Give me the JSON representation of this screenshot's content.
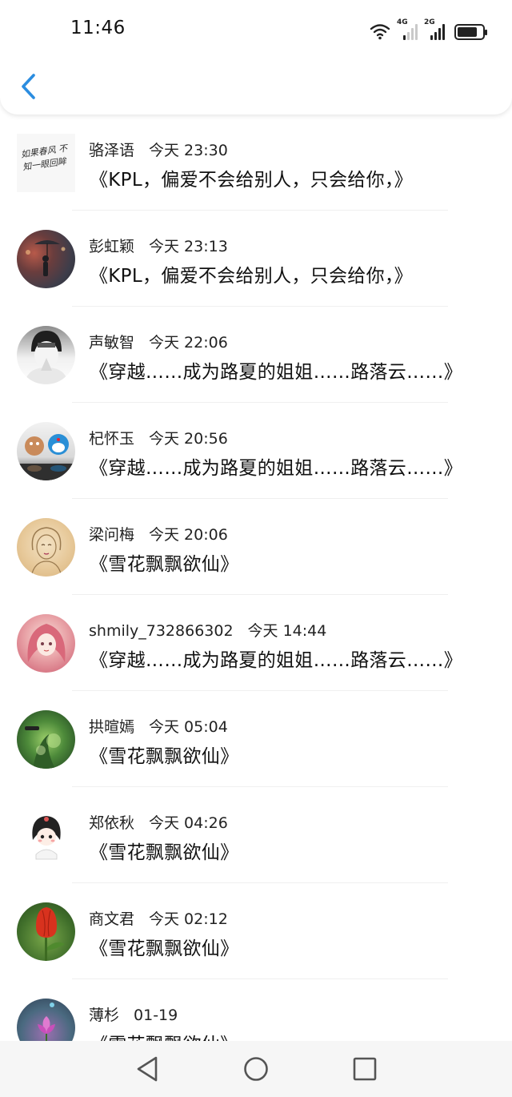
{
  "status_bar": {
    "time": "11:46",
    "network_1": "4G",
    "network_2": "2G",
    "icons": [
      "wifi-icon",
      "signal-4g-icon",
      "signal-2g-icon",
      "battery-icon"
    ]
  },
  "header": {
    "back_icon": "chevron-left-icon"
  },
  "colors": {
    "accent": "#2b8de0",
    "text": "#111111",
    "divider": "#efefef"
  },
  "comments": [
    {
      "name": "骆泽语",
      "time": "今天 23:30",
      "message": "《KPL，偏爱不会给别人，只会给你，》",
      "avatar_text": "如果春风 不知一眼回眸"
    },
    {
      "name": "彭虹颖",
      "time": "今天 23:13",
      "message": "《KPL，偏爱不会给别人，只会给你，》"
    },
    {
      "name": "声敏智",
      "time": "今天 22:06",
      "message": "《穿越……成为路夏的姐姐……路落云……》"
    },
    {
      "name": "杞怀玉",
      "time": "今天 20:56",
      "message": "《穿越……成为路夏的姐姐……路落云……》"
    },
    {
      "name": "梁问梅",
      "time": "今天 20:06",
      "message": "《雪花飘飘欲仙》"
    },
    {
      "name": "shmily_732866302",
      "time": "今天 14:44",
      "message": "《穿越……成为路夏的姐姐……路落云……》"
    },
    {
      "name": "拱暄嫣",
      "time": "今天 05:04",
      "message": "《雪花飘飘欲仙》"
    },
    {
      "name": "郑依秋",
      "time": "今天 04:26",
      "message": "《雪花飘飘欲仙》"
    },
    {
      "name": "商文君",
      "time": "今天 02:12",
      "message": "《雪花飘飘欲仙》"
    },
    {
      "name": "薄杉",
      "time": "01-19",
      "message": "《雪花飘飘欲仙》"
    }
  ],
  "nav": {
    "back_icon": "triangle-back-icon",
    "home_icon": "circle-home-icon",
    "recents_icon": "square-recents-icon"
  }
}
